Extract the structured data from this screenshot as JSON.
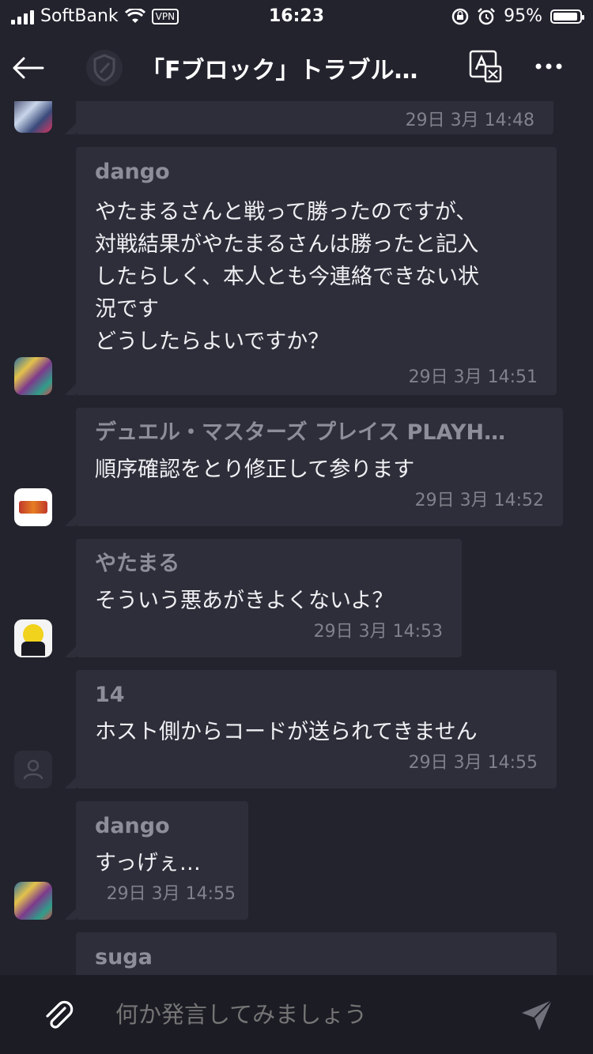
{
  "status_bar": {
    "carrier": "SoftBank",
    "vpn": "VPN",
    "time": "16:23",
    "battery": "95%",
    "battery_level": 0.95
  },
  "header": {
    "title": "「Fブロック」トラブル…",
    "icons": [
      "back-arrow-icon",
      "shield-icon",
      "translate-icon",
      "more-icon"
    ]
  },
  "messages": [
    {
      "name": "",
      "text": "",
      "time": "29日 3月 14:48",
      "avatar": "avatar-art-1"
    },
    {
      "name": "dango",
      "text": "やたまるさんと戦って勝ったのですが、\n対戦結果がやたまるさんは勝ったと記入\nしたらしく、本人とも今連絡できない状\n況です\nどうしたらよいですか？",
      "time": "29日 3月 14:51",
      "avatar": "avatar-art-2"
    },
    {
      "name": "デュエル・マスターズ プレイス PLAYH…",
      "text": "順序確認をとり修正して参ります",
      "time": "29日 3月 14:52",
      "avatar": "avatar-logo"
    },
    {
      "name": "やたまる",
      "text": "そういう悪あがきよくないよ？",
      "time": "29日 3月 14:53",
      "avatar": "avatar-character"
    },
    {
      "name": "14",
      "text": "ホスト側からコードが送られてきません",
      "time": "29日 3月 14:55",
      "avatar": "avatar-default"
    },
    {
      "name": "dango",
      "text": "すっげぇ…",
      "time": "29日 3月 14:55",
      "avatar": "avatar-art-2"
    },
    {
      "name": "suga",
      "text": "",
      "time": "",
      "avatar": ""
    }
  ],
  "composer": {
    "placeholder": "何か発言してみましょう"
  }
}
